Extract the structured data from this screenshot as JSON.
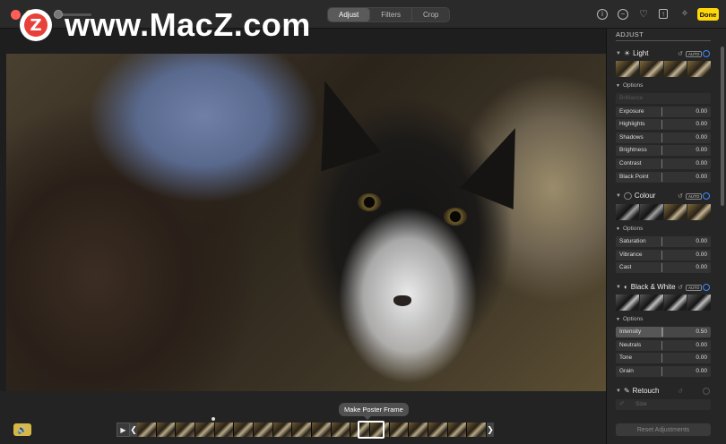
{
  "watermark": {
    "logo_letter": "Z",
    "text": "www.MacZ.com"
  },
  "toolbar": {
    "tabs": [
      {
        "label": "Adjust",
        "active": true
      },
      {
        "label": "Filters",
        "active": false
      },
      {
        "label": "Crop",
        "active": false
      }
    ],
    "icons": [
      "info-icon",
      "minus-circle-icon",
      "heart-icon",
      "share-icon",
      "magic-wand-icon"
    ],
    "done_label": "Done",
    "done_color": "#ffd60a"
  },
  "video": {
    "poster_tooltip": "Make Poster Frame",
    "frame_count": 18
  },
  "sidebar": {
    "header": "ADJUST",
    "auto_label": "AUTO",
    "options_label": "Options",
    "light": {
      "title": "Light",
      "dim_row": "Brilliance",
      "rows": [
        {
          "label": "Exposure",
          "value": "0.00"
        },
        {
          "label": "Highlights",
          "value": "0.00"
        },
        {
          "label": "Shadows",
          "value": "0.00"
        },
        {
          "label": "Brightness",
          "value": "0.00"
        },
        {
          "label": "Contrast",
          "value": "0.00"
        },
        {
          "label": "Black Point",
          "value": "0.00"
        }
      ]
    },
    "colour": {
      "title": "Colour",
      "rows": [
        {
          "label": "Saturation",
          "value": "0.00"
        },
        {
          "label": "Vibrance",
          "value": "0.00"
        },
        {
          "label": "Cast",
          "value": "0.00"
        }
      ]
    },
    "bw": {
      "title": "Black & White",
      "rows": [
        {
          "label": "Intensity",
          "value": "0.50"
        },
        {
          "label": "Neutrals",
          "value": "0.00"
        },
        {
          "label": "Tone",
          "value": "0.00"
        },
        {
          "label": "Grain",
          "value": "0.00"
        }
      ]
    },
    "retouch": {
      "title": "Retouch",
      "size_label": "Size"
    },
    "reset_label": "Reset Adjustments",
    "accent_color": "#3a8bff"
  }
}
